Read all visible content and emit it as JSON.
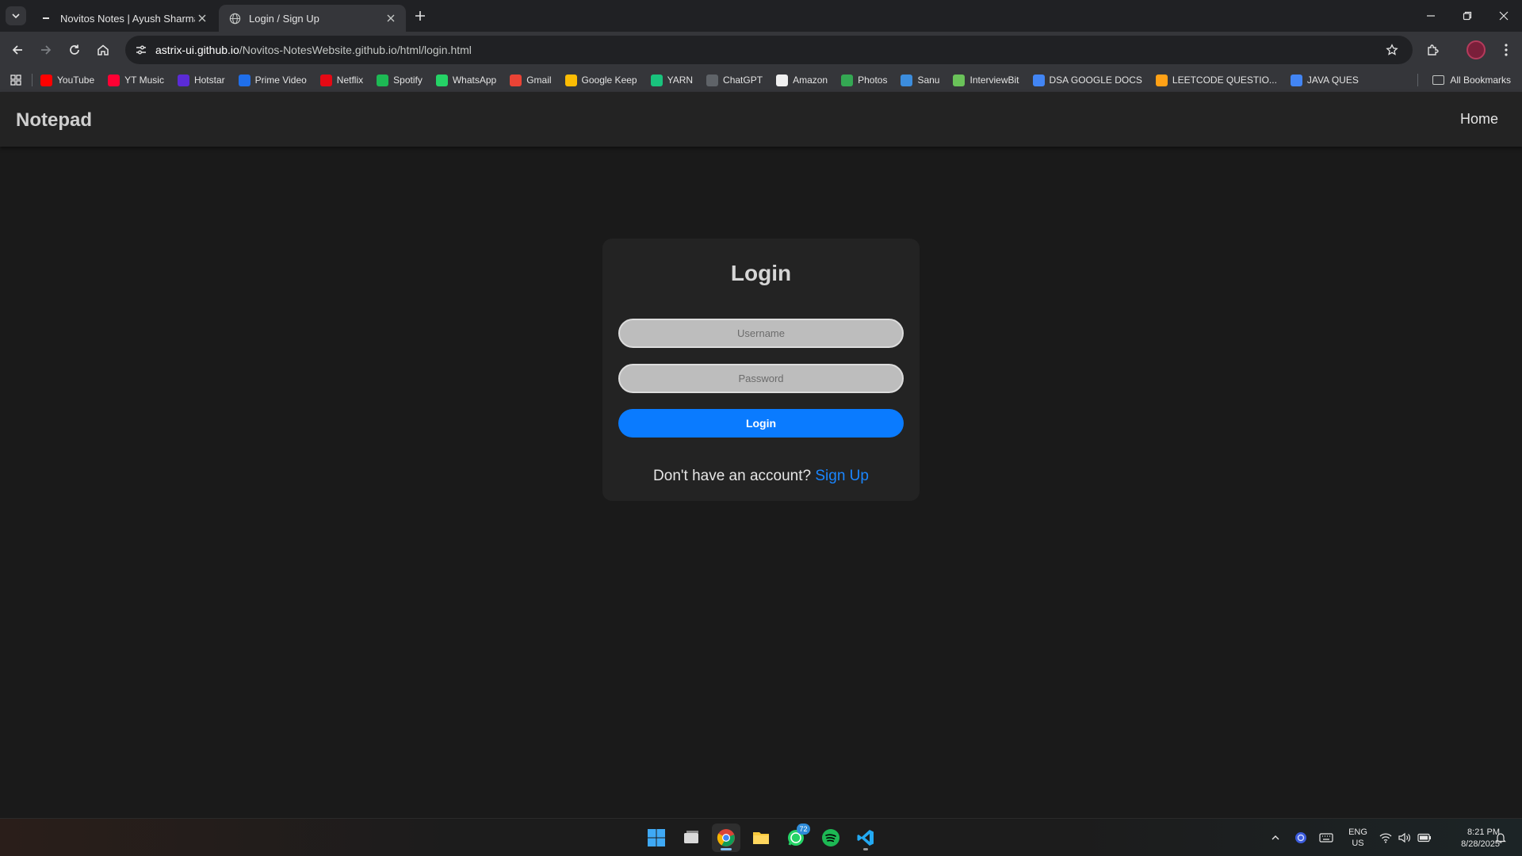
{
  "browser": {
    "tabs": [
      {
        "title": "Novitos Notes | Ayush Sharma",
        "active": false
      },
      {
        "title": "Login / Sign Up",
        "active": true
      }
    ],
    "url_host": "astrix-ui.github.io",
    "url_path": "/Novitos-NotesWebsite.github.io/html/login.html",
    "bookmarks": [
      {
        "label": "YouTube",
        "icon": "youtube-icon",
        "color": "#ff0000"
      },
      {
        "label": "YT Music",
        "icon": "yt-music-icon",
        "color": "#ff0033"
      },
      {
        "label": "Hotstar",
        "icon": "hotstar-icon",
        "color": "#5b2bd6"
      },
      {
        "label": "Prime Video",
        "icon": "prime-video-icon",
        "color": "#1f6feb"
      },
      {
        "label": "Netflix",
        "icon": "netflix-icon",
        "color": "#e50914"
      },
      {
        "label": "Spotify",
        "icon": "spotify-icon",
        "color": "#1db954"
      },
      {
        "label": "WhatsApp",
        "icon": "whatsapp-icon",
        "color": "#25d366"
      },
      {
        "label": "Gmail",
        "icon": "gmail-icon",
        "color": "#ea4335"
      },
      {
        "label": "Google Keep",
        "icon": "google-keep-icon",
        "color": "#fbbc04"
      },
      {
        "label": "YARN",
        "icon": "yarn-icon",
        "color": "#19c37d"
      },
      {
        "label": "ChatGPT",
        "icon": "chatgpt-icon",
        "color": "#5f6368"
      },
      {
        "label": "Amazon",
        "icon": "amazon-icon",
        "color": "#f0f0f0"
      },
      {
        "label": "Photos",
        "icon": "google-photos-icon",
        "color": "#34a853"
      },
      {
        "label": "Sanu",
        "icon": "sanu-icon",
        "color": "#3c8dde"
      },
      {
        "label": "InterviewBit",
        "icon": "interviewbit-icon",
        "color": "#6ac259"
      },
      {
        "label": "DSA GOOGLE DOCS",
        "icon": "google-docs-icon",
        "color": "#4285f4"
      },
      {
        "label": "LEETCODE QUESTIO...",
        "icon": "leetcode-icon",
        "color": "#ffa116"
      },
      {
        "label": "JAVA QUES",
        "icon": "google-docs-icon",
        "color": "#4285f4"
      }
    ],
    "all_bookmarks": "All Bookmarks"
  },
  "site": {
    "brand": "Notepad",
    "nav_home": "Home"
  },
  "login": {
    "title": "Login",
    "username_placeholder": "Username",
    "password_placeholder": "Password",
    "button_label": "Login",
    "signup_prompt": "Don't have an account?",
    "signup_link": "Sign Up",
    "accent_color": "#0a7bff"
  },
  "taskbar": {
    "whatsapp_badge": "72",
    "lang_top": "ENG",
    "lang_bottom": "US",
    "time": "8:21 PM",
    "date": "8/28/2025"
  }
}
